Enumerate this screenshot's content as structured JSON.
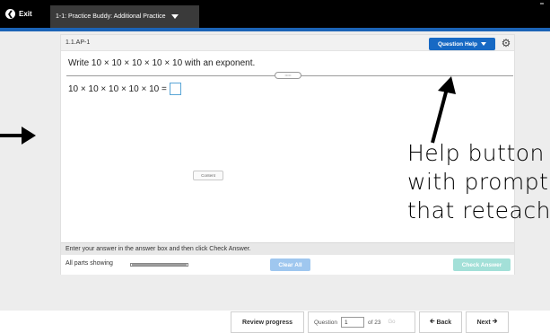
{
  "topbar": {
    "exit_label": "Exit",
    "assignment_title": "1-1: Practice Buddy: Additional Practice"
  },
  "panel": {
    "problem_id": "1.1.AP-1",
    "help_button_label": "Question Help",
    "instruction": "Write 10 × 10 × 10 × 10 × 10 with an exponent.",
    "expression": "10 × 10 × 10 × 10 × 10 =",
    "content_label": "Content",
    "answer_instruction": "Enter your answer in the answer box and then click Check Answer.",
    "parts_label": "All parts showing",
    "parts_progress": 1.0,
    "clear_all_label": "Clear All",
    "check_answer_label": "Check Answer"
  },
  "footer": {
    "review_label": "Review progress",
    "question_label": "Question",
    "question_number": "1",
    "of_total": "of 23",
    "go_label": "Go",
    "back_label": "Back",
    "next_label": "Next"
  },
  "annotation": {
    "text": "Help button\nwith prompts\nthat reteach"
  },
  "colors": {
    "brand_blue": "#1769c4",
    "check_answer": "#a3e0d8",
    "clear_all": "#9fc7ef"
  }
}
